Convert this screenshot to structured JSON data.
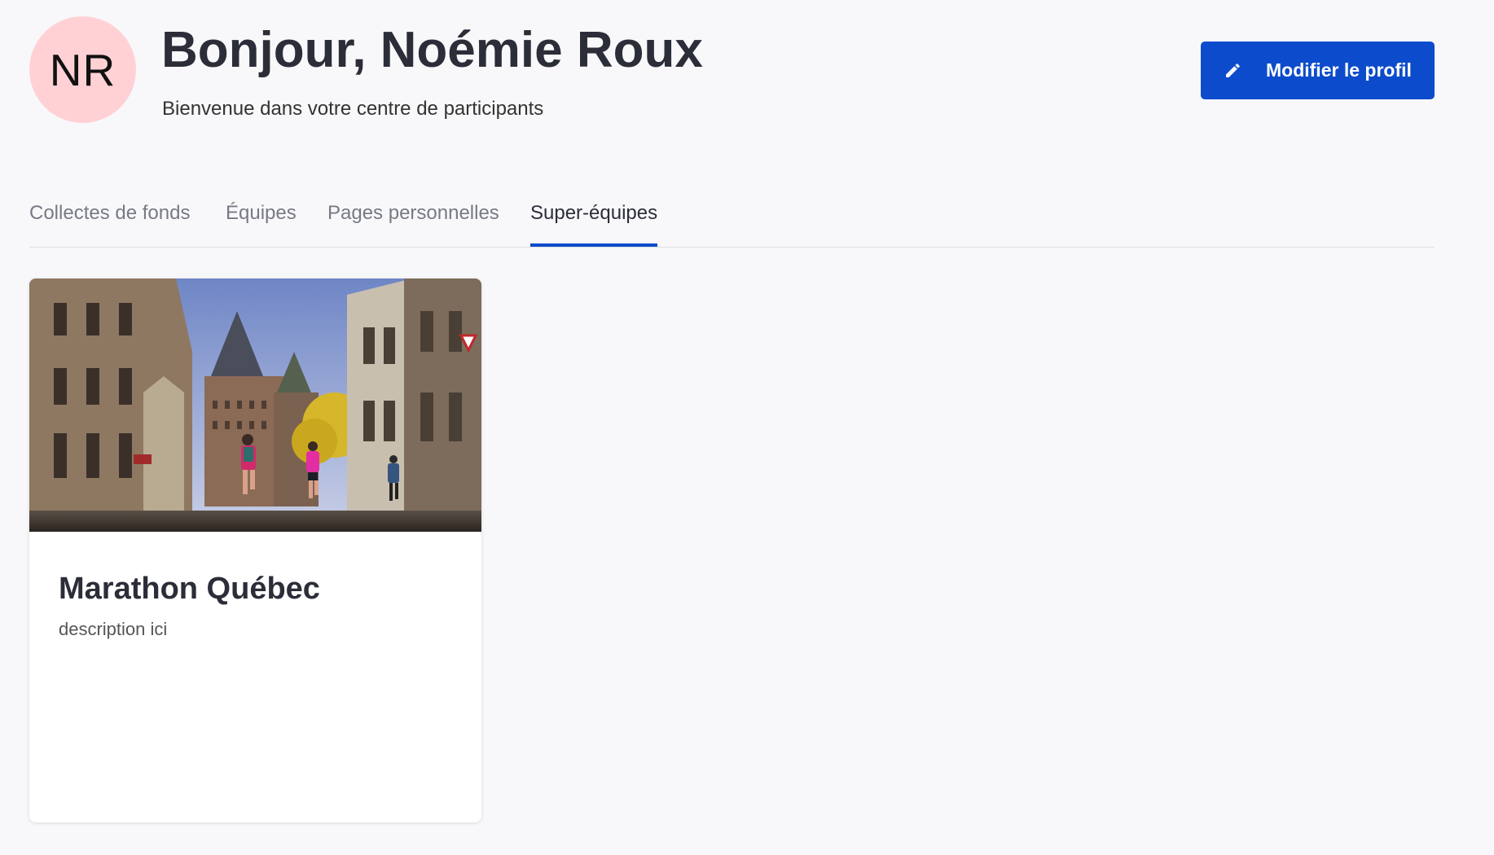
{
  "profile": {
    "initials": "NR",
    "avatar_color": "#ffd1d5",
    "greeting": "Bonjour, Noémie Roux",
    "subtitle": "Bienvenue dans votre centre de participants",
    "edit_button_label": "Modifier le profil",
    "edit_button_icon": "pencil-icon"
  },
  "tabs": [
    {
      "label": "Collectes de fonds",
      "active": false
    },
    {
      "label": "Équipes",
      "active": false
    },
    {
      "label": "Pages personnelles",
      "active": false
    },
    {
      "label": "Super-équipes",
      "active": true
    }
  ],
  "cards": [
    {
      "title": "Marathon Québec",
      "description": "description ici"
    }
  ],
  "colors": {
    "accent": "#0c4ccc",
    "background": "#f8f8fa",
    "text": "#2b2d38",
    "muted_text": "#777a85"
  }
}
